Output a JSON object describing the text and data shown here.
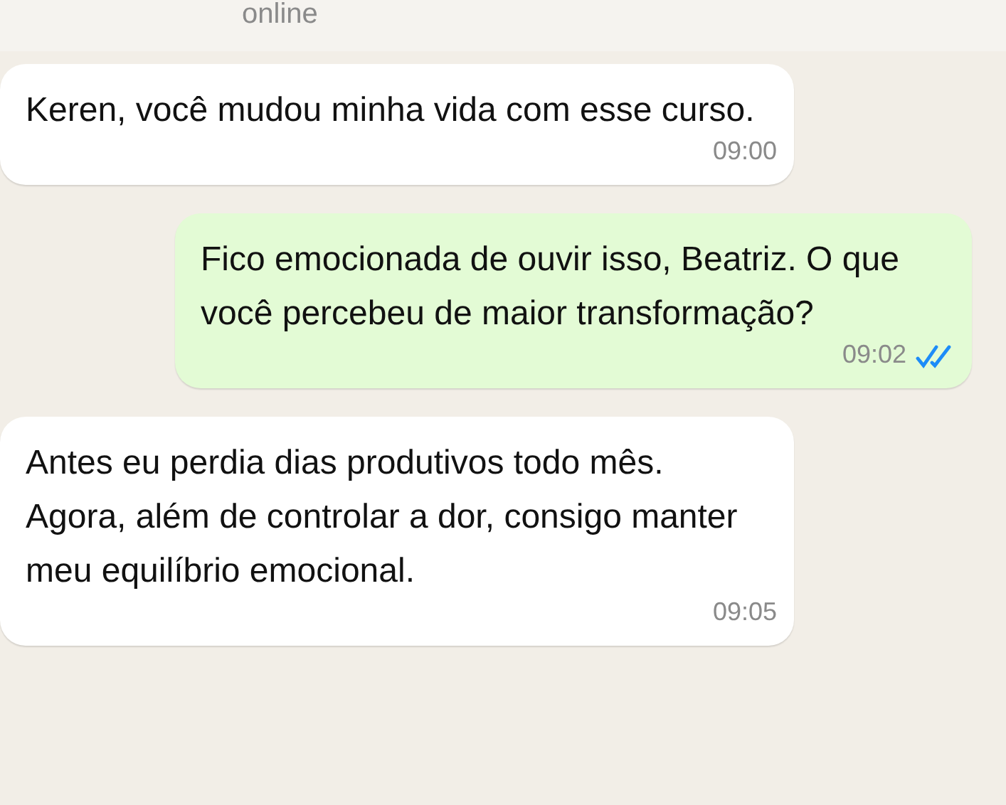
{
  "header": {
    "status": "online"
  },
  "messages": [
    {
      "kind": "incoming",
      "text": "Keren, você mudou minha vida com esse curso.",
      "time": "09:00"
    },
    {
      "kind": "outgoing",
      "text": "Fico emocionada de ouvir isso, Beatriz. O que você percebeu de maior transformação?",
      "time": "09:02",
      "read": true
    },
    {
      "kind": "incoming",
      "text": "Antes eu perdia dias produtivos todo mês. Agora, além de controlar a dor, consigo manter meu equilíbrio emocional.",
      "time": "09:05"
    }
  ]
}
